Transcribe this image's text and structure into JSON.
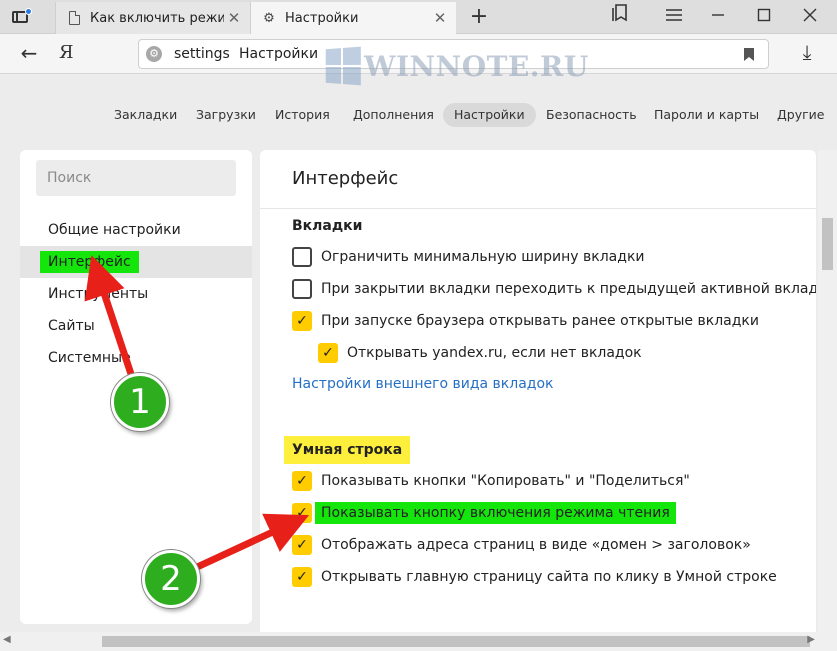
{
  "tabs": [
    {
      "label": "Как включить режим чтен",
      "icon": "document-icon"
    },
    {
      "label": "Настройки",
      "icon": "gear-icon"
    }
  ],
  "address": {
    "host": "settings",
    "title": "Настройки",
    "ya": "Я"
  },
  "watermark": "WINNOTE.RU",
  "settings_nav": [
    "Закладки",
    "Загрузки",
    "История",
    "Дополнения",
    "Настройки",
    "Безопасность",
    "Пароли и карты",
    "Другие"
  ],
  "sidebar": {
    "search_placeholder": "Поиск",
    "items": [
      "Общие настройки",
      "Интерфейс",
      "Инструменты",
      "Сайты",
      "Системные"
    ]
  },
  "content": {
    "title": "Интерфейс",
    "tabs_section": {
      "title": "Вкладки",
      "options": [
        {
          "label": "Ограничить минимальную ширину вкладки",
          "checked": false
        },
        {
          "label": "При закрытии вкладки переходить к предыдущей активной вкладке",
          "checked": false
        },
        {
          "label": "При запуске браузера открывать ранее открытые вкладки",
          "checked": true
        },
        {
          "label": "Открывать yandex.ru, если нет вкладок",
          "checked": true
        }
      ],
      "link": "Настройки внешнего вида вкладок"
    },
    "smart_section": {
      "title": "Умная строка",
      "options": [
        {
          "label": "Показывать кнопки \"Копировать\" и \"Поделиться\"",
          "checked": true
        },
        {
          "label": "Показывать кнопку включения режима чтения",
          "checked": true
        },
        {
          "label": "Отображать адреса страниц в виде «домен > заголовок»",
          "checked": true
        },
        {
          "label": "Открывать главную страницу сайта по клику в Умной строке",
          "checked": true
        }
      ]
    }
  },
  "badges": [
    "1",
    "2"
  ],
  "colors": {
    "accent_check": "#ffcc00",
    "highlight_green": "#14e60c",
    "highlight_yellow": "#ffef3d",
    "link": "#2570c4",
    "arrow": "#e8201a",
    "badge": "#2eae1f"
  }
}
